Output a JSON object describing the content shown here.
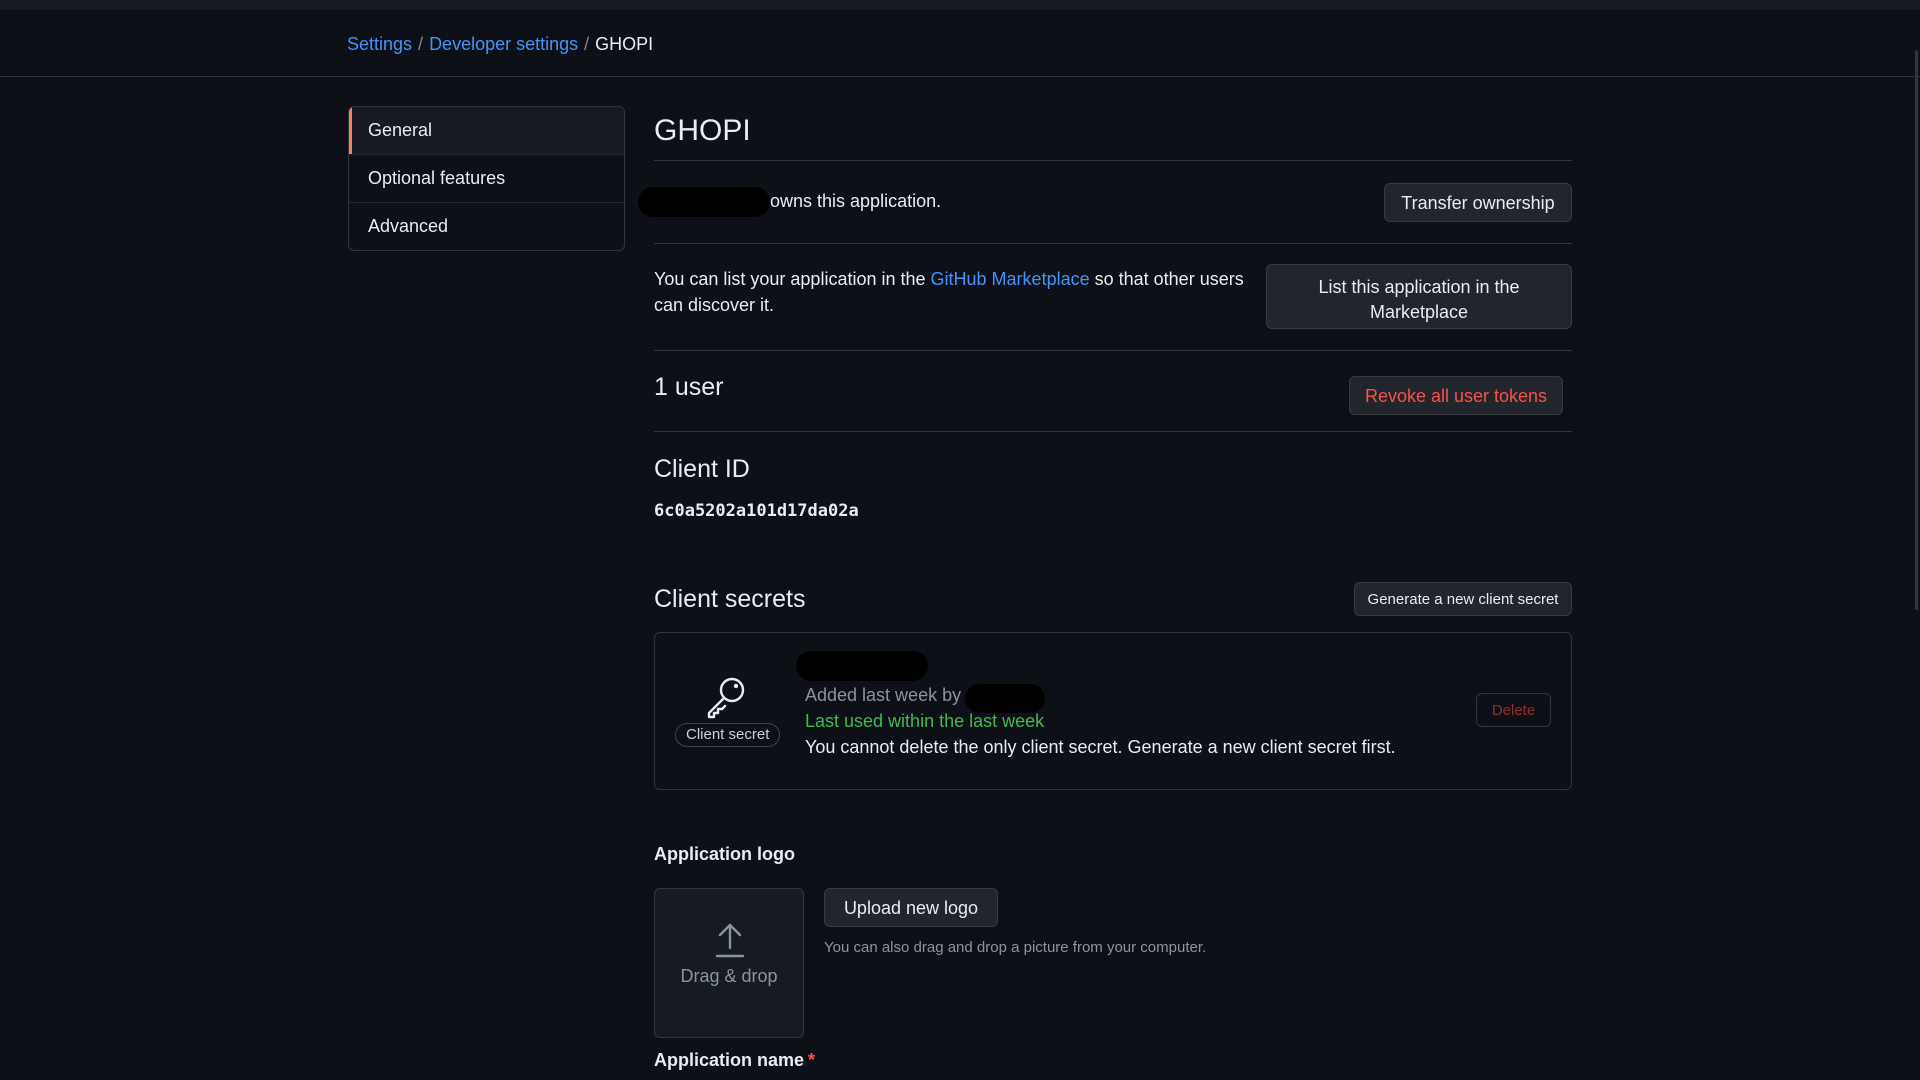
{
  "breadcrumb": {
    "settings": "Settings",
    "developer_settings": "Developer settings",
    "current": "GHOPI",
    "separator": "/"
  },
  "sidebar": {
    "items": [
      {
        "label": "General",
        "active": true
      },
      {
        "label": "Optional features",
        "active": false
      },
      {
        "label": "Advanced",
        "active": false
      }
    ]
  },
  "app": {
    "title": "GHOPI",
    "owner_suffix": "owns this application.",
    "transfer_label": "Transfer ownership",
    "marketplace_prefix": "You can list your application in the",
    "marketplace_link": "GitHub Marketplace",
    "marketplace_suffix": "so that other users can discover it.",
    "marketplace_button": "List this application in the Marketplace",
    "users_count": "1 user",
    "revoke_label": "Revoke all user tokens",
    "client_id_heading": "Client ID",
    "client_id": "6c0a5202a101d17da02a",
    "client_secrets_heading": "Client secrets",
    "generate_secret_label": "Generate a new client secret"
  },
  "secret": {
    "badge": "Client secret",
    "added": "Added last week by",
    "last_used": "Last used within the last week",
    "warning": "You cannot delete the only client secret. Generate a new client secret first.",
    "delete_label": "Delete"
  },
  "logo": {
    "heading": "Application logo",
    "drag_drop": "Drag & drop",
    "upload_label": "Upload new logo",
    "hint": "You can also drag and drop a picture from your computer."
  },
  "app_name": {
    "heading": "Application name",
    "required_mark": "*"
  },
  "colors": {
    "background": "#0d1117",
    "link": "#4493f8",
    "danger": "#f85149",
    "success": "#3fb950",
    "active_indicator": "#f78166"
  },
  "icons": {
    "key": "key-icon",
    "upload": "upload-icon"
  }
}
